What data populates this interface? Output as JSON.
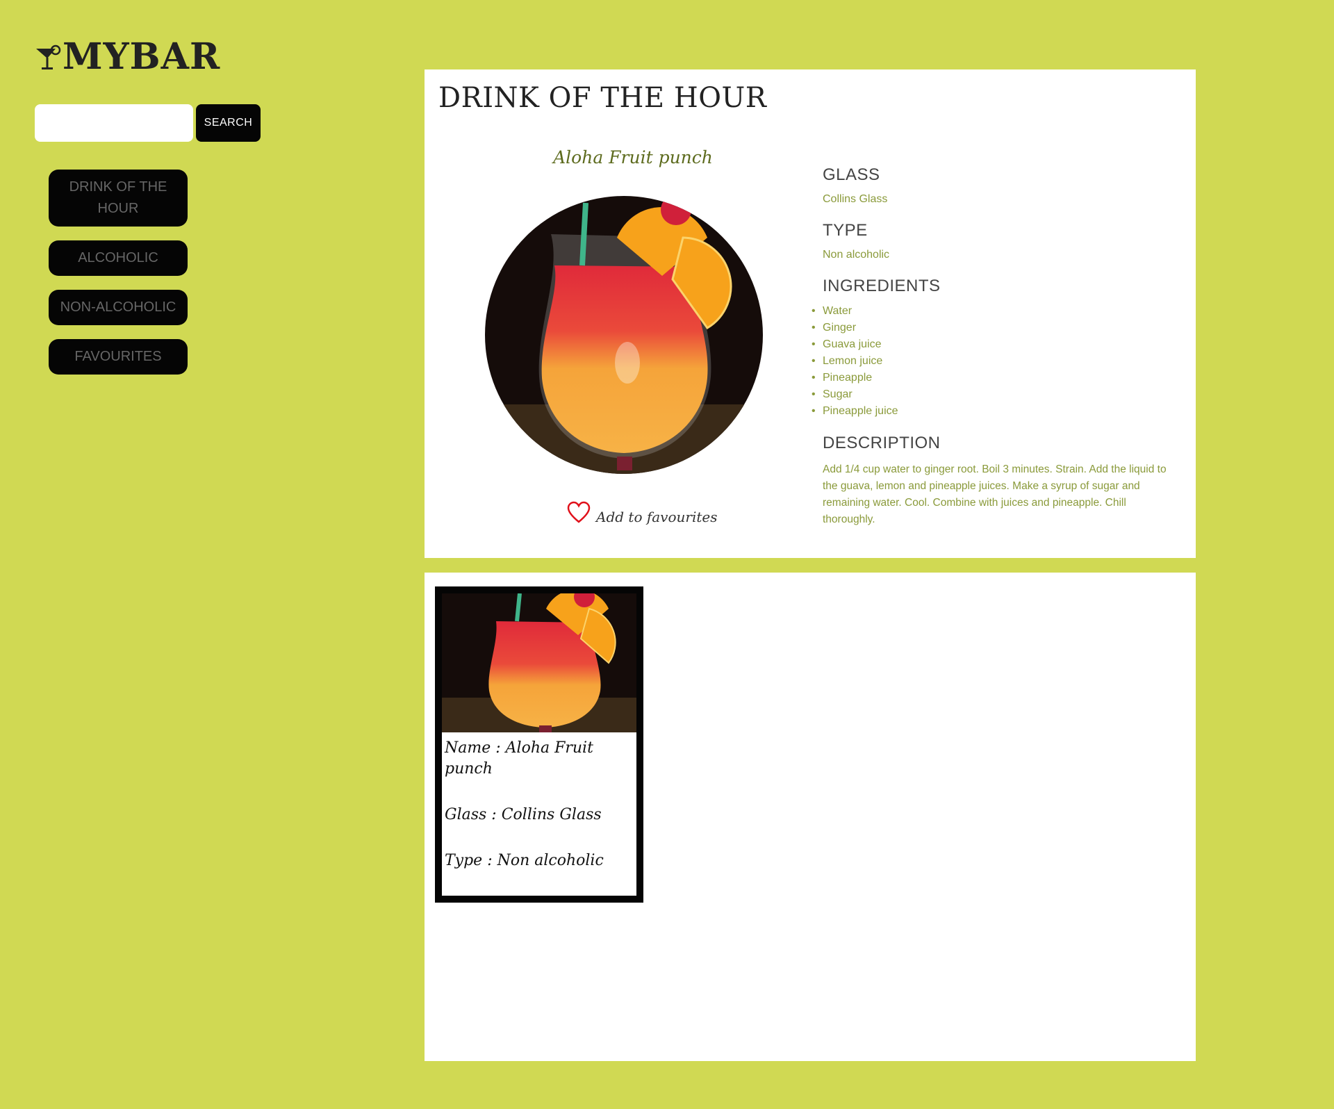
{
  "app": {
    "logo_text": "MYBAR",
    "logo_icon": "cocktail-glass-icon"
  },
  "search": {
    "value": "",
    "placeholder": "",
    "button_label": "SEARCH"
  },
  "nav": {
    "items": [
      {
        "label": "DRINK OF THE HOUR"
      },
      {
        "label": "ALCOHOLIC"
      },
      {
        "label": "NON-ALCOHOLIC"
      },
      {
        "label": "FAVOURITES"
      }
    ]
  },
  "drink_of_hour": {
    "heading": "DRINK OF THE HOUR",
    "name": "Aloha Fruit punch",
    "add_fav_label": "Add to favourites",
    "fav_icon": "heart-outline-icon",
    "glass_heading": "GLASS",
    "glass": "Collins Glass",
    "type_heading": "TYPE",
    "type": "Non alcoholic",
    "ingredients_heading": "INGREDIENTS",
    "ingredients": [
      "Water",
      "Ginger",
      "Guava juice",
      "Lemon juice",
      "Pineapple",
      "Sugar",
      "Pineapple juice"
    ],
    "description_heading": "DESCRIPTION",
    "description": "Add 1/4 cup water to ginger root. Boil 3 minutes. Strain. Add the liquid to the guava, lemon and pineapple juices. Make a syrup of sugar and remaining water. Cool. Combine with juices and pineapple. Chill thoroughly."
  },
  "cards": [
    {
      "name_line": "Name : Aloha Fruit punch",
      "glass_line": "Glass : Collins Glass",
      "type_line": "Type : Non alcoholic"
    }
  ],
  "colors": {
    "page_bg": "#d0d953",
    "panel_bg": "#ffffff",
    "button_bg": "#050505",
    "accent_text": "#8a9a3a",
    "heart": "#e0101a"
  }
}
